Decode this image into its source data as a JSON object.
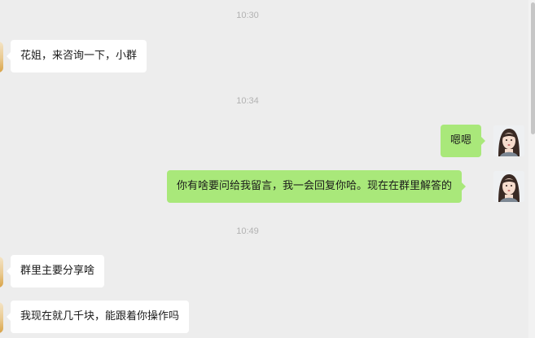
{
  "chat": {
    "timestamps": [
      "10:30",
      "10:34",
      "10:49"
    ],
    "messages": [
      {
        "from": "other",
        "text": "花姐，来咨询一下，小群"
      },
      {
        "from": "me",
        "text": "嗯嗯"
      },
      {
        "from": "me",
        "text": "你有啥要问给我留言，我一会回复你哈。现在在群里解答的"
      },
      {
        "from": "other",
        "text": "群里主要分享啥"
      },
      {
        "from": "other",
        "text": "我现在就几千块，能跟着你操作吗"
      }
    ]
  },
  "colors": {
    "background": "#ededed",
    "incoming_bubble": "#ffffff",
    "outgoing_bubble": "#a9e87a",
    "timestamp_text": "#b2b2b2"
  }
}
